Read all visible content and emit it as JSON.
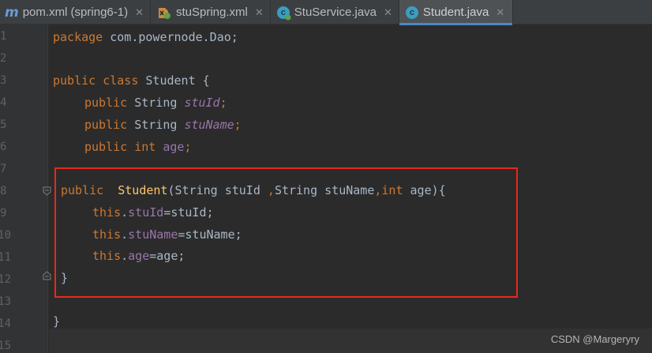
{
  "tabs": [
    {
      "label": "pom.xml (spring6-1)",
      "icon": "maven-icon",
      "active": false
    },
    {
      "label": "stuSpring.xml",
      "icon": "spring-xml-icon",
      "active": false
    },
    {
      "label": "StuService.java",
      "icon": "java-class-icon",
      "active": false
    },
    {
      "label": "Student.java",
      "icon": "java-class-icon",
      "active": true
    }
  ],
  "tab_close_glyph": "✕",
  "icon_text": {
    "maven": "m",
    "java_class": "c"
  },
  "gutter": [
    "1",
    "2",
    "3",
    "4",
    "5",
    "6",
    "7",
    "8",
    "9",
    "10",
    "11",
    "12",
    "13",
    "14",
    "15"
  ],
  "code": {
    "l1_kw": "package",
    "l1_rest": " com.powernode.Dao;",
    "l3_kw": "public class",
    "l3_rest": " Student {",
    "l4_kw": "public",
    "l4_type": " String ",
    "l4_field": "stuId",
    "l4_end": ";",
    "l5_kw": "public",
    "l5_type": " String ",
    "l5_field": "stuName",
    "l5_end": ";",
    "l6_kw": "public int",
    "l6_field": " age",
    "l6_end": ";",
    "l8_kw": "public",
    "l8_name": "Student",
    "l8_a": "(String stuId ",
    "l8_c1": ",",
    "l8_b": "String stuName",
    "l8_c2": ",",
    "l8_kw2": "int",
    "l8_end": " age){",
    "l9_kw": "this",
    "l9_dot": ".",
    "l9_field": "stuId",
    "l9_end": "=stuId;",
    "l10_kw": "this",
    "l10_dot": ".",
    "l10_field": "stuName",
    "l10_end": "=stuName;",
    "l11_kw": "this",
    "l11_dot": ".",
    "l11_field": "age",
    "l11_end": "=age;",
    "l12": "}",
    "l14": "}"
  },
  "watermark": "CSDN @Margeryry",
  "colors": {
    "keyword": "#cc7832",
    "field": "#9876aa",
    "method": "#ffc66d",
    "text": "#a9b7c6",
    "highlight_box": "#e8281e",
    "active_tab_underline": "#4a88c7"
  }
}
